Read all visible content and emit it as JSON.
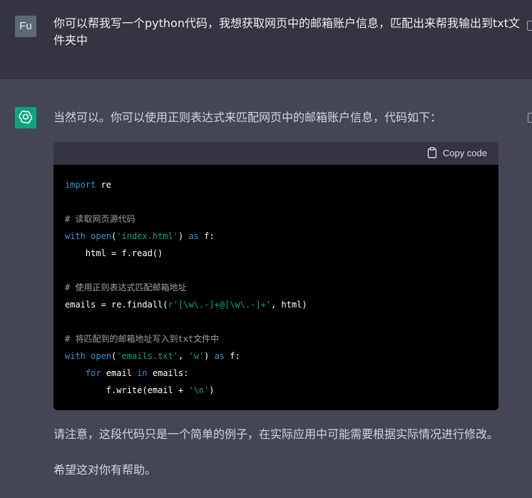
{
  "user": {
    "avatar_label": "Fu",
    "message": "你可以帮我写一个python代码，我想获取网页中的邮箱账户信息，匹配出来帮我输出到txt文件夹中"
  },
  "assistant": {
    "intro": "当然可以。你可以使用正则表达式来匹配网页中的邮箱账户信息，代码如下：",
    "copy_label": "Copy code",
    "code": {
      "l1_kw": "import",
      "l1_rest": " re",
      "l3": "# 读取网页源代码",
      "l4_kw": "with",
      "l4_fn": "open",
      "l4_str": "'index.html'",
      "l4_as": "as",
      "l5": "    html = f.read()",
      "l7": "# 使用正则表达式匹配邮箱地址",
      "l8_pre": "emails = re.findall(",
      "l8_str": "r'[\\w\\.-]+@[\\w\\.-]+'",
      "l8_post": ", html)",
      "l10": "# 将匹配到的邮箱地址写入到txt文件中",
      "l11_kw": "with",
      "l11_fn": "open",
      "l11_str1": "'emails.txt'",
      "l11_str2": "'w'",
      "l11_as": "as",
      "l12_for": "for",
      "l12_var": " email ",
      "l12_in": "in",
      "l12_rest": " emails:",
      "l13_pre": "        f.write(email + ",
      "l13_str": "'\\n'",
      "l13_post": ")"
    },
    "note": "请注意，这段代码只是一个简单的例子，在实际应用中可能需要根据实际情况进行修改。",
    "closing": "希望这对你有帮助。"
  },
  "colors": {
    "user_bg": "#343541",
    "assistant_bg": "#444654",
    "gpt_avatar": "#10a37f",
    "keyword": "#2e95d3",
    "string": "#00a67d",
    "function": "#df3079",
    "comment": "#a0a0a0"
  },
  "icons": [
    "edit-icon",
    "openai-logo-icon",
    "clipboard-icon",
    "thumb-icon"
  ]
}
